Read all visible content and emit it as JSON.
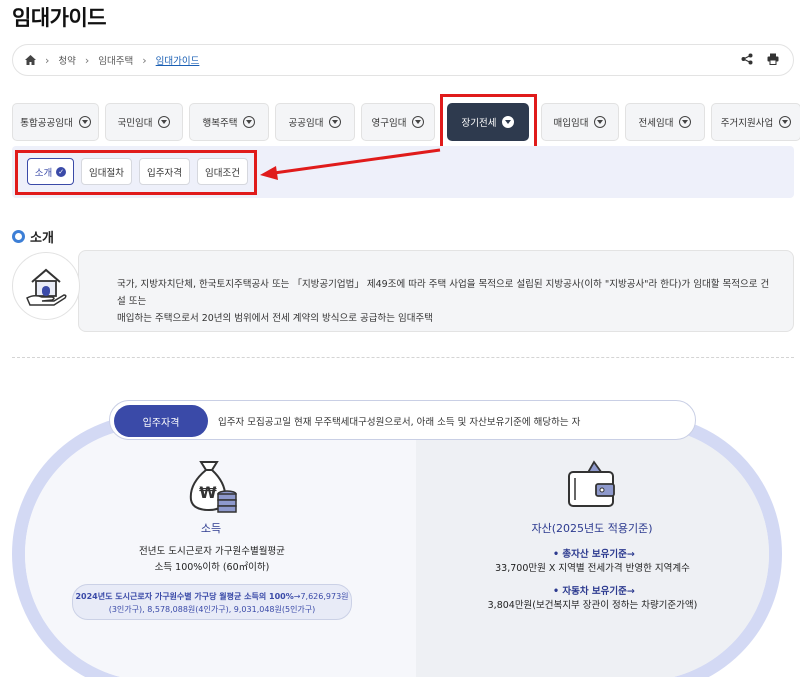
{
  "page": {
    "title": "임대가이드"
  },
  "breadcrumb": {
    "items": [
      "청약",
      "임대주택",
      "임대가이드"
    ]
  },
  "tabs": [
    {
      "label": "통합공공임대"
    },
    {
      "label": "국민임대"
    },
    {
      "label": "행복주택"
    },
    {
      "label": "공공임대"
    },
    {
      "label": "영구임대"
    },
    {
      "label": "장기전세"
    },
    {
      "label": "매입임대"
    },
    {
      "label": "전세임대"
    },
    {
      "label": "주거지원사업"
    }
  ],
  "subtabs": [
    {
      "label": "소개"
    },
    {
      "label": "임대절차"
    },
    {
      "label": "입주자격"
    },
    {
      "label": "임대조건"
    }
  ],
  "intro": {
    "title": "소개",
    "line1": "국가, 지방자치단체, 한국토지주택공사 또는 「지방공기업법」 제49조에 따라 주택 사업을 목적으로 설립된 지방공사(이하 \"지방공사\"라 한다)가 임대할 목적으로 건설 또는",
    "line2": "매입하는 주택으로서 20년의 범위에서 전세 계약의 방식으로 공급하는 임대주택"
  },
  "eligibility": {
    "label": "입주자격",
    "desc": "입주자 모집공고일 현재 무주택세대구성원으로서, 아래 소득 및 자산보유기준에 해당하는 자",
    "income": {
      "title": "소득",
      "line1": "전년도 도시근로자 가구원수별월평균",
      "line2": "소득 100%이하 (60㎡이하)",
      "note_bold": "2024년도 도시근로자 가구원수별 가구당 월평균 소득의 100%",
      "note_rest1": "→7,626,973원",
      "note_line2": "(3인가구), 8,578,088원(4인가구), 9,031,048원(5인가구)"
    },
    "asset": {
      "title": "자산(2025년도 적용기준)",
      "total_label": "총자산 보유기준",
      "total_value": "33,700만원 X 지역별 전세가격 반영한 지역계수",
      "car_label": "자동차 보유기준",
      "car_value": "3,804만원(보건복지부 장관이 정하는 차량기준가액)"
    }
  },
  "colors": {
    "accent": "#3a4aa8",
    "active_tab": "#2e3a4e",
    "highlight": "#e01b1b",
    "oval_border": "#d3d9f4"
  }
}
